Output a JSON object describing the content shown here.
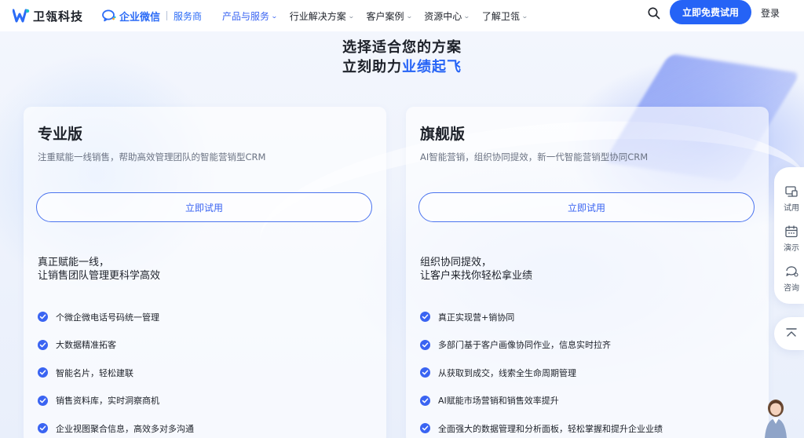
{
  "header": {
    "brand_name": "卫瓴科技",
    "partner_name": "企业微信",
    "partner_sub": "服务商",
    "nav": [
      {
        "label": "产品与服务",
        "active": true
      },
      {
        "label": "行业解决方案",
        "active": false
      },
      {
        "label": "客户案例",
        "active": false
      },
      {
        "label": "资源中心",
        "active": false
      },
      {
        "label": "了解卫瓴",
        "active": false
      }
    ],
    "cta_label": "立即免费试用",
    "login_label": "登录",
    "icons": {
      "search": "search-icon",
      "logo": "logo-icon",
      "partner": "wecom-icon"
    }
  },
  "hero": {
    "title_line1": "选择适合您的方案",
    "title_line2_prefix": "立刻助力",
    "title_line2_accent": "业绩起飞"
  },
  "plans": [
    {
      "name": "专业版",
      "description": "注重赋能一线销售，帮助高效管理团队的智能营销型CRM",
      "button_label": "立即试用",
      "subtitle_line1": "真正赋能一线，",
      "subtitle_line2": "让销售团队管理更科学高效",
      "features": [
        "个微企微电话号码统一管理",
        "大数据精准拓客",
        "智能名片，轻松建联",
        "销售资料库，实时洞察商机",
        "企业视图聚合信息，高效多对多沟通"
      ]
    },
    {
      "name": "旗舰版",
      "description": "AI智能营销，组织协同提效，新一代智能营销型协同CRM",
      "button_label": "立即试用",
      "subtitle_line1": "组织协同提效，",
      "subtitle_line2": "让客户来找你轻松拿业绩",
      "features": [
        "真正实现营+销协同",
        "多部门基于客户画像协同作业，信息实时拉齐",
        "从获取到成交，线索全生命周期管理",
        "AI赋能市场营销和销售效率提升",
        "全面强大的数据管理和分析面板，轻松掌握和提升企业业绩"
      ]
    }
  ],
  "side_panel": {
    "items": [
      {
        "label": "试用",
        "icon": "trial-icon"
      },
      {
        "label": "演示",
        "icon": "calendar-icon"
      },
      {
        "label": "咨询",
        "icon": "chat-icon"
      }
    ],
    "back_to_top_icon": "back-to-top-icon"
  },
  "colors": {
    "accent": "#2563f6",
    "nav_active": "#3a64f2",
    "text": "#1d2129",
    "muted": "#6b7383"
  }
}
